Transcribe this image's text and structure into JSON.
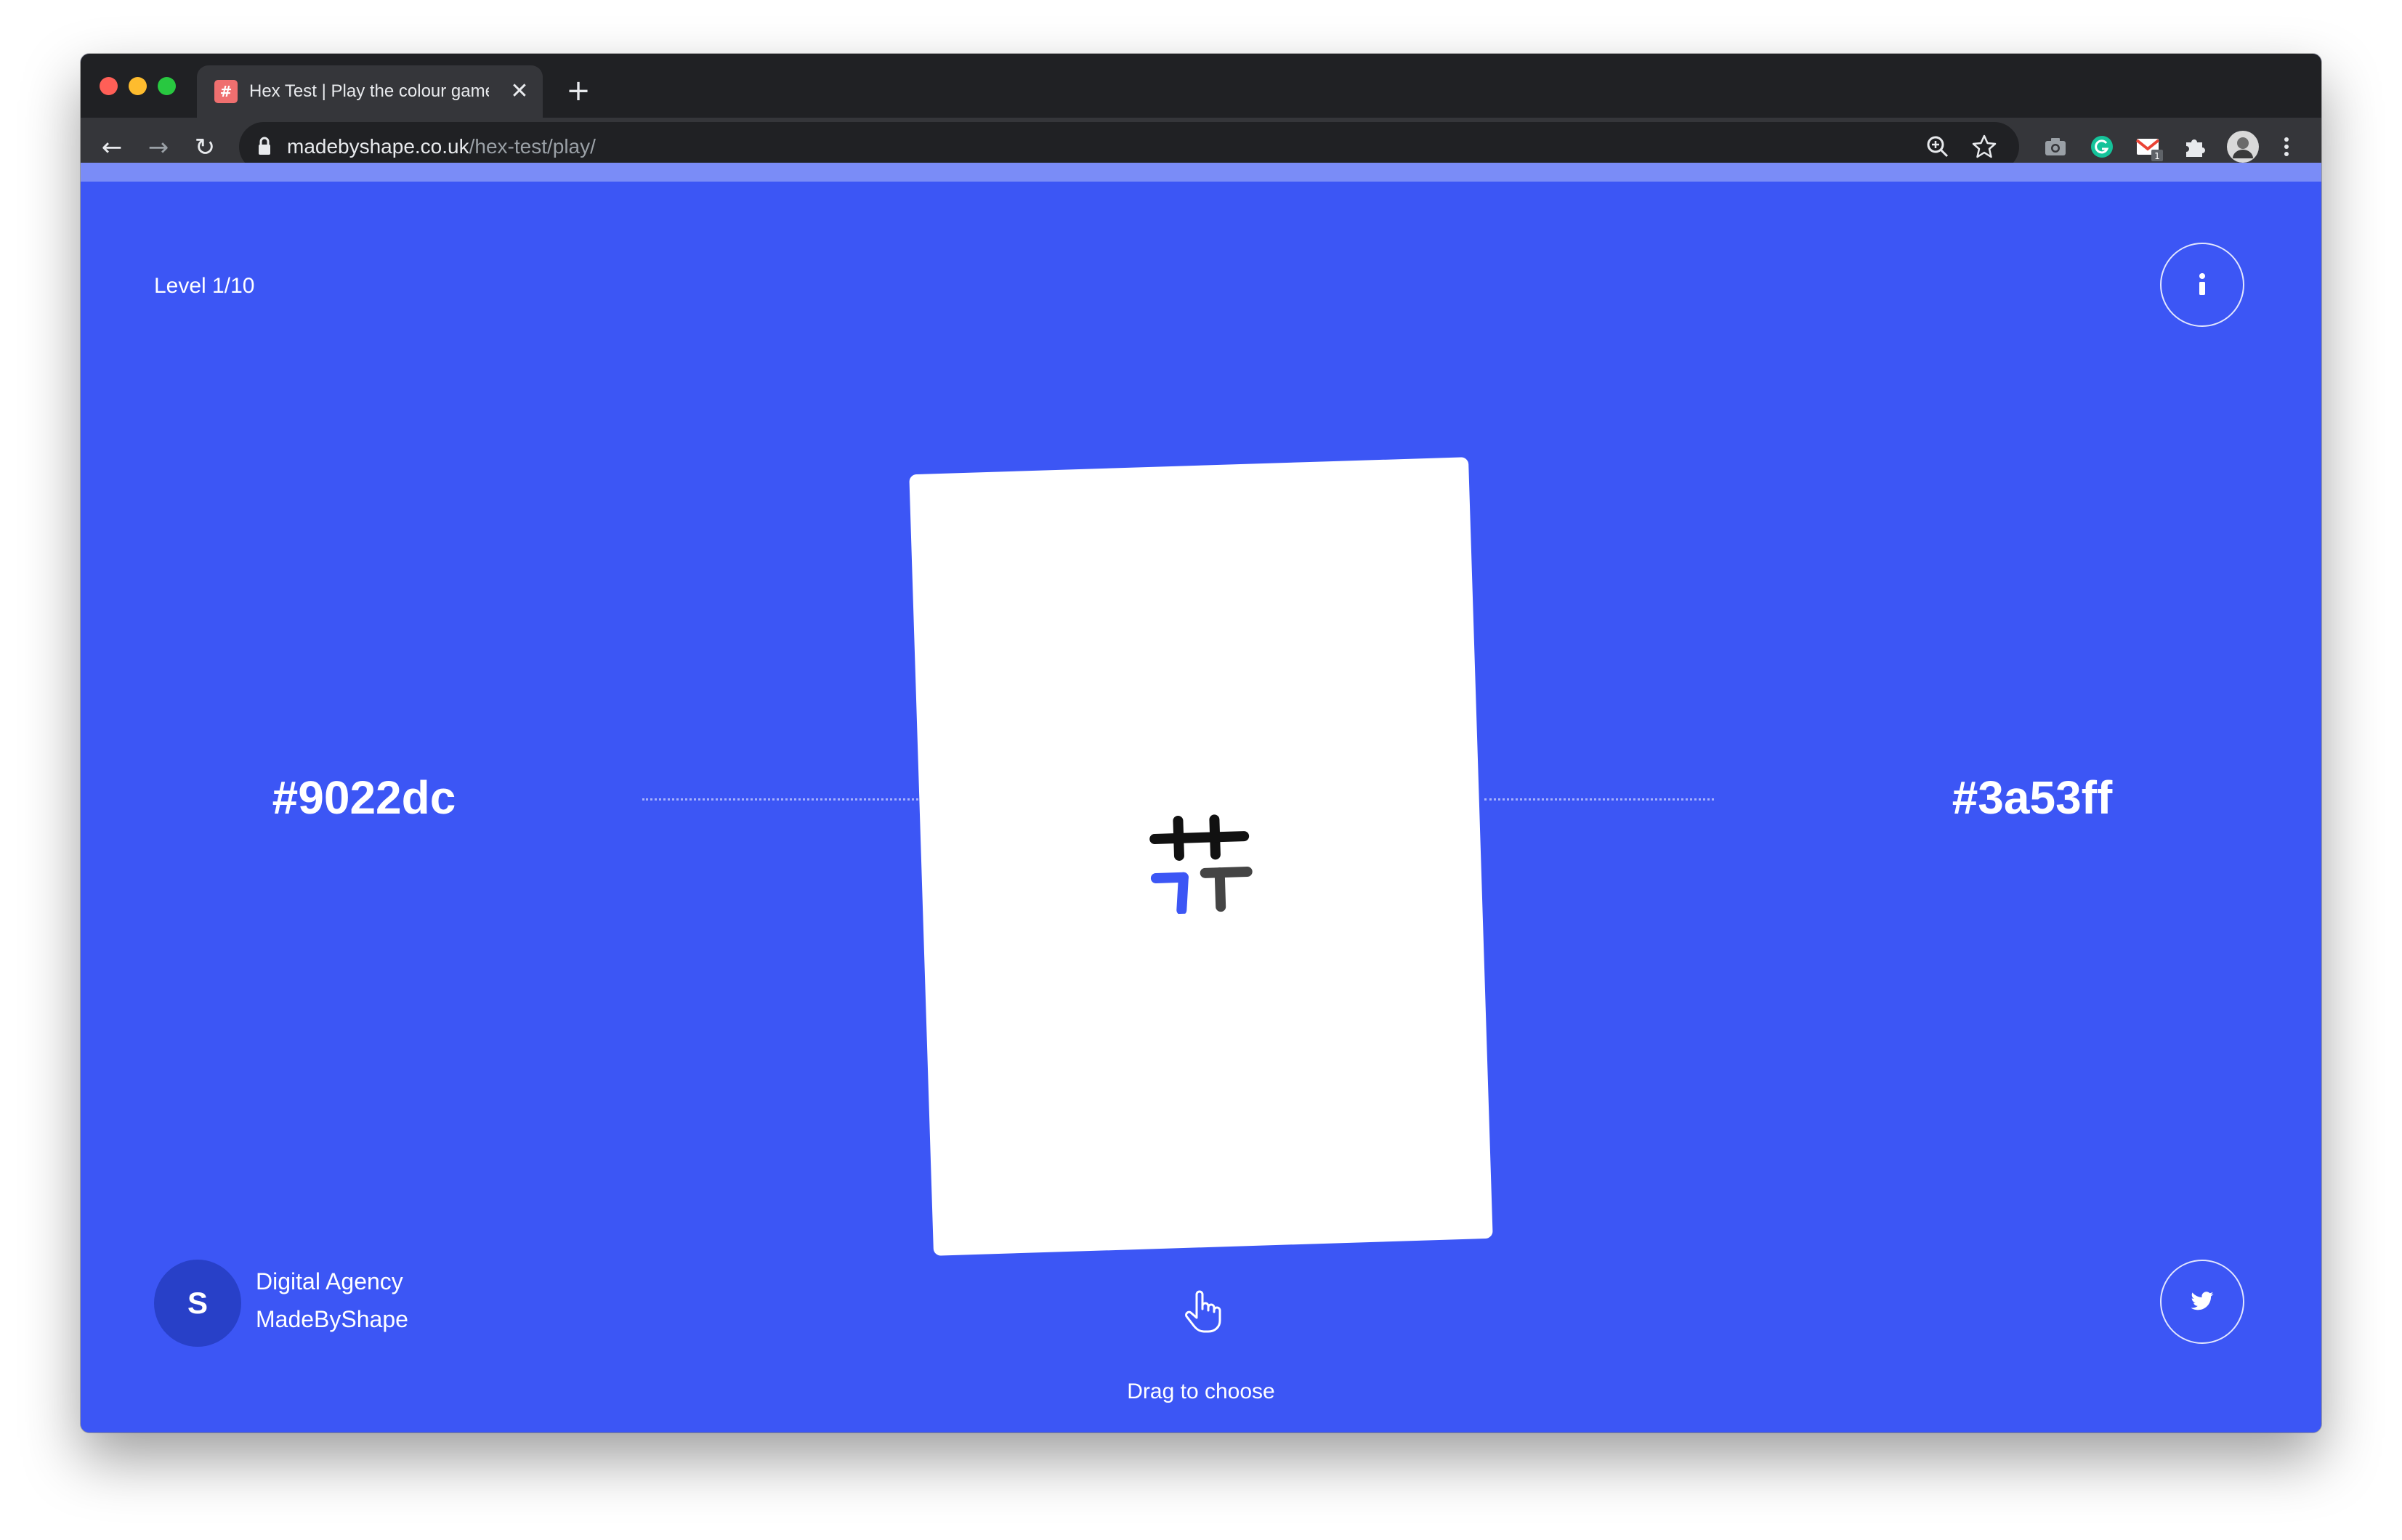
{
  "browser": {
    "tab": {
      "title": "Hex Test | Play the colour game",
      "favicon": "#",
      "close_glyph": "✕"
    },
    "new_tab_glyph": "+",
    "nav": {
      "back_glyph": "←",
      "forward_glyph": "→",
      "reload_glyph": "↻"
    },
    "url": {
      "host": "madebyshape.co.uk",
      "path": "/hex-test/play/"
    },
    "omnibox_icons": [
      "zoom-icon",
      "bookmark-star-icon"
    ],
    "extensions": [
      "camera-extension-icon",
      "grammarly-extension-icon",
      "gmail-extension-icon",
      "puzzle-extensions-icon",
      "profile-avatar",
      "menu-kebab-icon"
    ],
    "extension_badge": "1"
  },
  "game": {
    "level_label": "Level 1/10",
    "left_option": "#9022dc",
    "right_option": "#3a53ff",
    "drag_hint": "Drag to choose"
  },
  "footer": {
    "agency_initial": "S",
    "agency_line1": "Digital Agency",
    "agency_line2": "MadeByShape"
  },
  "colors": {
    "page_background": "#3c56f5",
    "accent_strip": "#7a8cf7",
    "card": "#ffffff",
    "chrome_dark": "#202124",
    "chrome_toolbar": "#35363a"
  }
}
